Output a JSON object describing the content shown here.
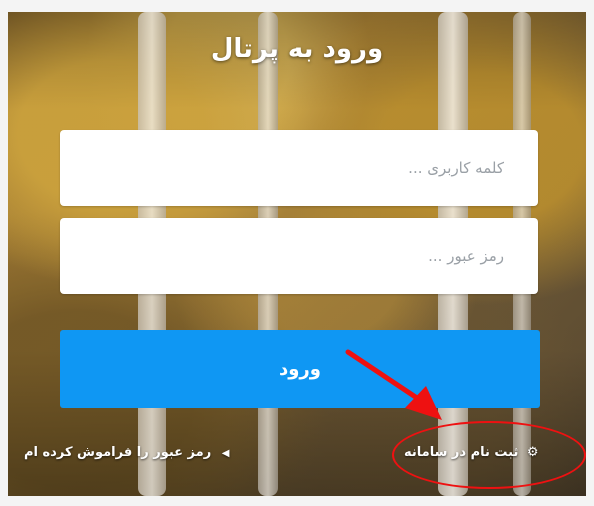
{
  "title": "ورود به پرتال",
  "username": {
    "placeholder": "... کلمه کاربری"
  },
  "password": {
    "placeholder": "... رمز عبور"
  },
  "login_button": {
    "label": "ورود"
  },
  "links": {
    "register": "ثبت نام در سامانه",
    "forgot_password": "رمز عبور را فراموش کرده ام"
  },
  "icons": {
    "register": "gear-icon",
    "forgot": "triangle-left-icon"
  },
  "colors": {
    "primary": "#0f97f3",
    "annotation": "#e11111"
  }
}
